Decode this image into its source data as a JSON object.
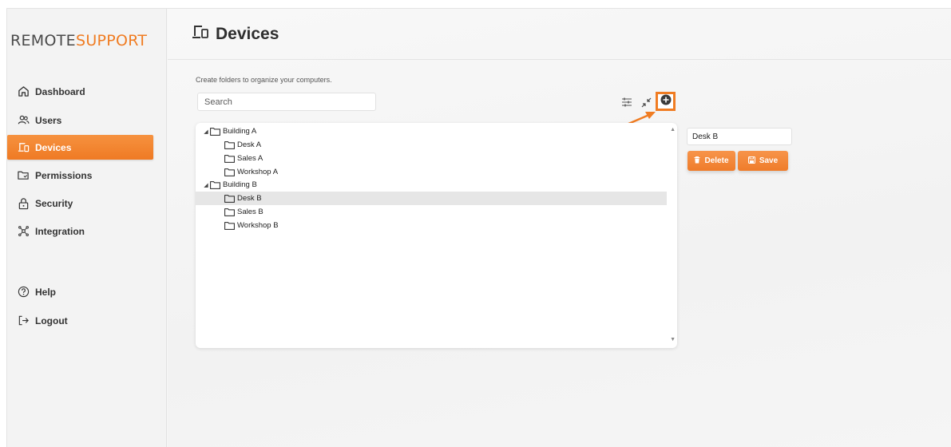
{
  "app": {
    "logo_part1": "REMOTE",
    "logo_part2": "SUPPORT"
  },
  "sidebar": {
    "items": [
      {
        "label": "Dashboard",
        "icon": "home-icon"
      },
      {
        "label": "Users",
        "icon": "users-icon"
      },
      {
        "label": "Devices",
        "icon": "devices-icon",
        "active": true
      },
      {
        "label": "Permissions",
        "icon": "permissions-icon"
      },
      {
        "label": "Security",
        "icon": "lock-icon"
      },
      {
        "label": "Integration",
        "icon": "integration-icon"
      },
      {
        "label": "Help",
        "icon": "help-icon"
      },
      {
        "label": "Logout",
        "icon": "logout-icon"
      }
    ]
  },
  "page": {
    "title": "Devices",
    "subtitle": "Create folders to organize your computers."
  },
  "search": {
    "placeholder": "Search",
    "value": ""
  },
  "toolbar": {
    "filter_icon": "filter-icon",
    "collapse_icon": "collapse-icon",
    "add_icon": "add-circle-icon"
  },
  "tree": {
    "nodes": [
      {
        "label": "Building A",
        "level": 0,
        "expanded": true
      },
      {
        "label": "Desk A",
        "level": 1
      },
      {
        "label": "Sales A",
        "level": 1
      },
      {
        "label": "Workshop A",
        "level": 1
      },
      {
        "label": "Building B",
        "level": 0,
        "expanded": true
      },
      {
        "label": "Desk B",
        "level": 1,
        "selected": true
      },
      {
        "label": "Sales B",
        "level": 1
      },
      {
        "label": "Workshop B",
        "level": 1
      }
    ]
  },
  "editor": {
    "name_value": "Desk B",
    "delete_label": "Delete",
    "save_label": "Save"
  },
  "colors": {
    "accent": "#f07c22",
    "selected_row": "#e6e6e6"
  }
}
